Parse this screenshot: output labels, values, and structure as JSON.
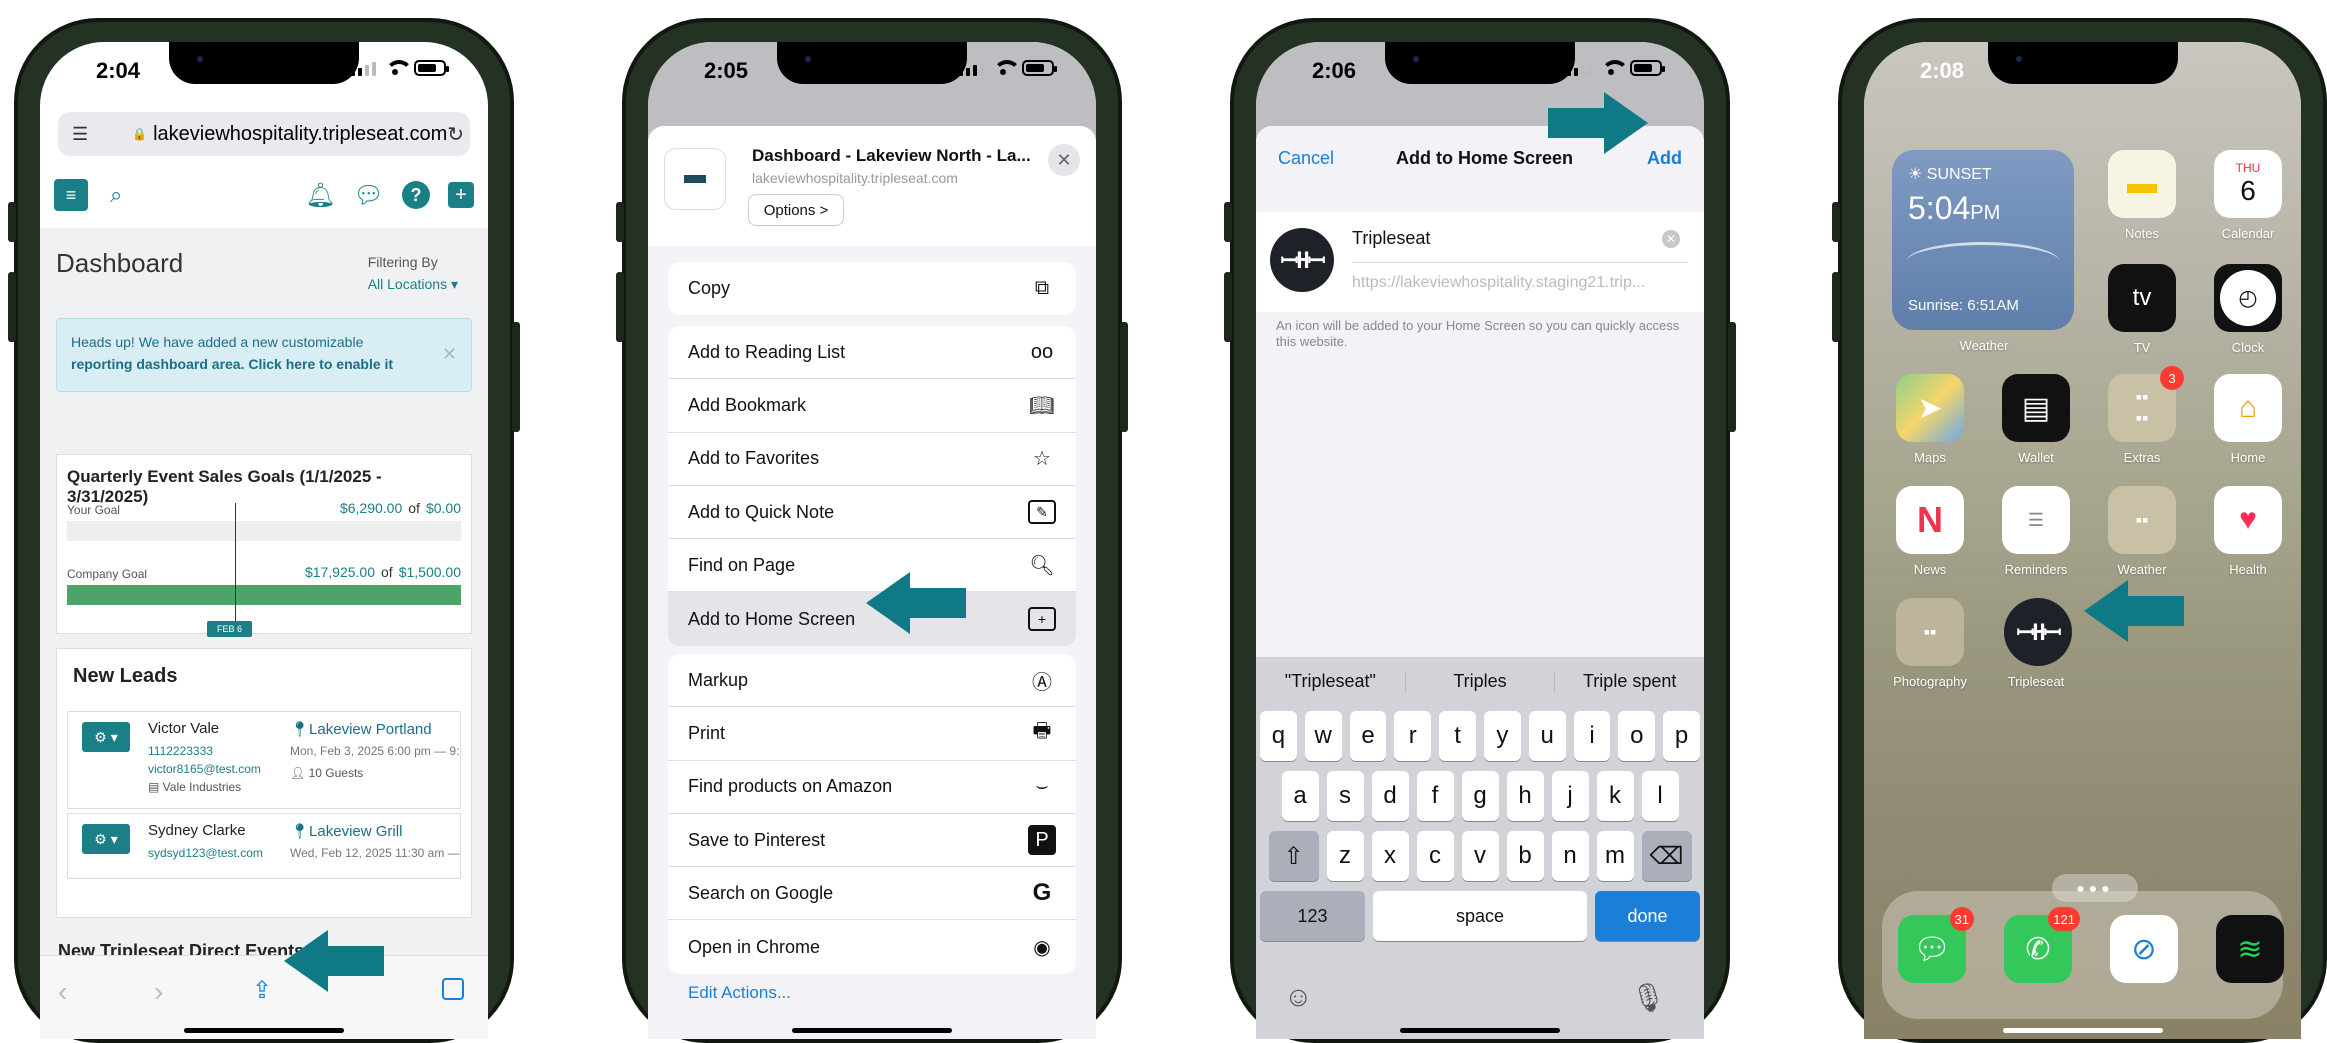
{
  "phone1": {
    "time": "2:04",
    "url": "lakeviewhospitality.tripleseat.com",
    "dashboard_title": "Dashboard",
    "filtering_label": "Filtering By",
    "filtering_value": "All Locations",
    "banner_line1": "Heads up! We have added a new customizable",
    "banner_line2": "reporting dashboard area. Click here to enable it",
    "goals_title": "Quarterly Event Sales Goals (1/1/2025 - 3/31/2025)",
    "your_goal_label": "Your Goal",
    "your_goal_value": "$6,290.00",
    "your_goal_actual": "$0.00",
    "company_goal_label": "Company Goal",
    "company_goal_value": "$17,925.00",
    "company_goal_actual": "$1,500.00",
    "of": "of",
    "date_marker": "FEB 6",
    "new_leads_title": "New Leads",
    "leads": [
      {
        "name": "Victor Vale",
        "phone": "1112223333",
        "email": "victor8165@test.com",
        "company": "Vale Industries",
        "location": "Lakeview Portland",
        "when": "Mon, Feb 3, 2025 6:00 pm — 9:",
        "guests": "10 Guests"
      },
      {
        "name": "Sydney Clarke",
        "email": "sydsyd123@test.com",
        "location": "Lakeview Grill",
        "when": "Wed, Feb 12, 2025 11:30 am —"
      }
    ],
    "peek_title": "New Tripleseat Direct Events"
  },
  "phone2": {
    "time": "2:05",
    "page_title": "Dashboard - Lakeview North - La...",
    "page_url": "lakeviewhospitality.tripleseat.com",
    "options": "Options >",
    "copy": "Copy",
    "group2": [
      "Add to Reading List",
      "Add Bookmark",
      "Add to Favorites",
      "Add to Quick Note",
      "Find on Page",
      "Add to Home Screen"
    ],
    "group3": [
      "Markup",
      "Print",
      "Find products on Amazon",
      "Save to Pinterest",
      "Search on Google",
      "Open in Chrome"
    ],
    "edit_actions": "Edit Actions..."
  },
  "phone3": {
    "time": "2:06",
    "cancel": "Cancel",
    "title": "Add to Home Screen",
    "add": "Add",
    "app_name": "Tripleseat",
    "url": "https://lakeviewhospitality.staging21.trip...",
    "hint": "An icon will be added to your Home Screen so you can quickly access this website.",
    "suggestions": [
      "\"Tripleseat\"",
      "Triples",
      "Triple spent"
    ],
    "row1": [
      "q",
      "w",
      "e",
      "r",
      "t",
      "y",
      "u",
      "i",
      "o",
      "p"
    ],
    "row2": [
      "a",
      "s",
      "d",
      "f",
      "g",
      "h",
      "j",
      "k",
      "l"
    ],
    "row3": [
      "z",
      "x",
      "c",
      "v",
      "b",
      "n",
      "m"
    ],
    "num_key": "123",
    "space_key": "space",
    "done_key": "done"
  },
  "phone4": {
    "time": "2:08",
    "weather_sunset": "SUNSET",
    "weather_time": "5:04",
    "weather_pm": "PM",
    "weather_sunrise": "Sunrise: 6:51AM",
    "weather_label": "Weather",
    "cal_day": "THU",
    "cal_date": "6",
    "apps": {
      "notes": "Notes",
      "calendar": "Calendar",
      "tv": "TV",
      "clock": "Clock",
      "maps": "Maps",
      "wallet": "Wallet",
      "extras": "Extras",
      "home": "Home",
      "news": "News",
      "reminders": "Reminders",
      "weather": "Weather",
      "health": "Health",
      "photography": "Photography",
      "tripleseat": "Tripleseat"
    },
    "extras_badge": "3",
    "messages_badge": "31",
    "phone_badge": "121"
  },
  "colors": {
    "accent": "#1a7f86",
    "arrow": "#0f7a85",
    "ios_blue": "#1a7fd8"
  }
}
